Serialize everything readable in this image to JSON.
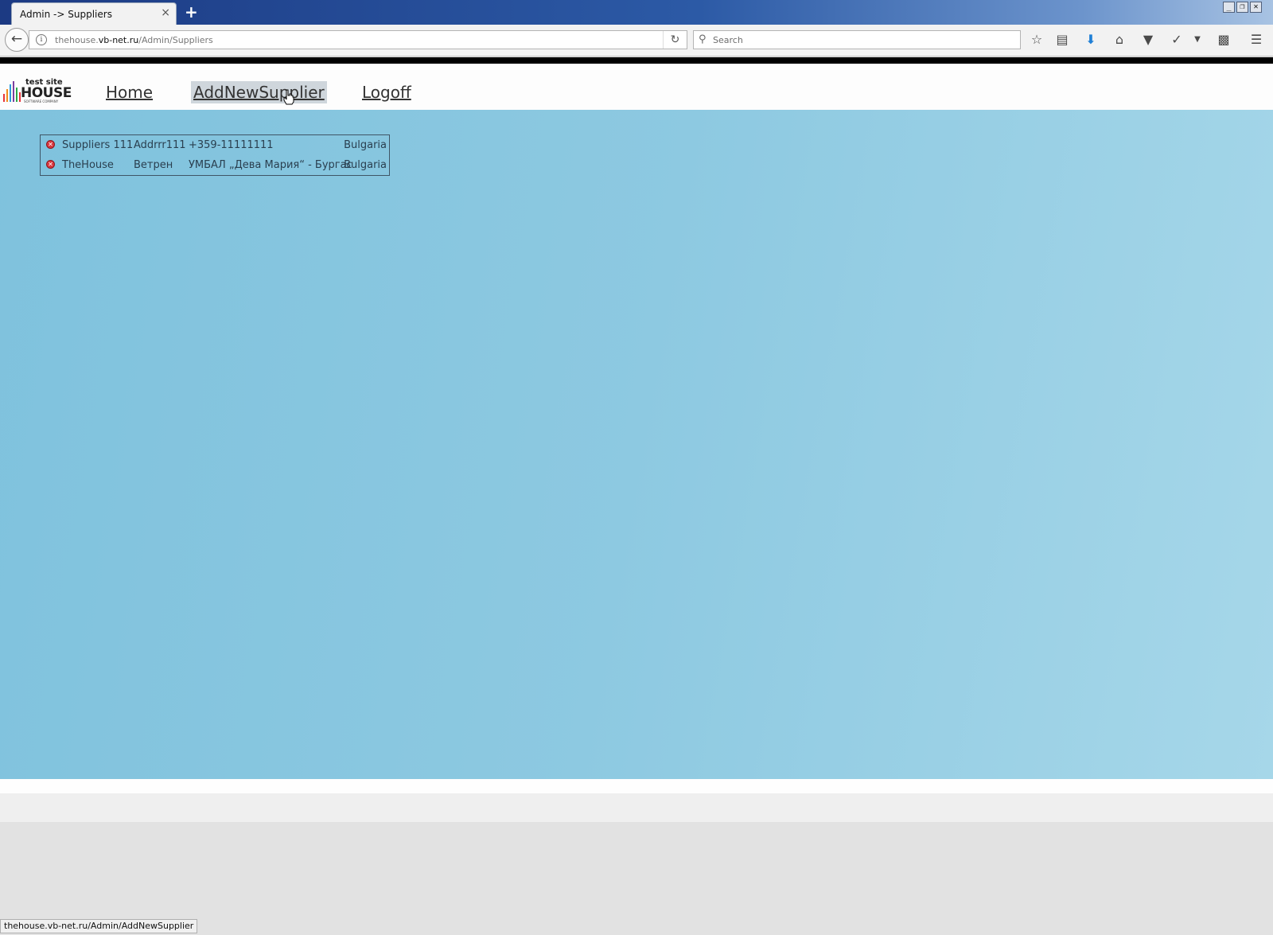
{
  "browser": {
    "tab_title": "Admin -> Suppliers",
    "tab_close": "×",
    "new_tab": "+",
    "url_prefix": "thehouse.",
    "url_domain": "vb-net.ru",
    "url_path": "/Admin/Suppliers",
    "search_placeholder": "Search",
    "status_url": "thehouse.vb-net.ru/Admin/AddNewSupplier",
    "window_controls": [
      "_",
      "❐",
      "✕"
    ]
  },
  "logo": {
    "top": "test site",
    "main": "HOUSE",
    "sub": "SOFTWARE COMPANY"
  },
  "menu": {
    "home": "Home",
    "add_new_supplier": "AddNewSupplier",
    "logoff": "Logoff"
  },
  "suppliers": [
    {
      "name": "Suppliers 111",
      "address": "Addrrr111",
      "phone": "+359-11111111",
      "country": "Bulgaria"
    },
    {
      "name": "TheHouse",
      "address": "Ветрен",
      "phone": "УМБАЛ „Дева Мария“ - Бургас",
      "country": "Bulgaria"
    }
  ],
  "colors": {
    "main_bg_start": "#7fc2dd",
    "main_bg_end": "#a6d7e9",
    "delete_icon": "#d9363e"
  }
}
